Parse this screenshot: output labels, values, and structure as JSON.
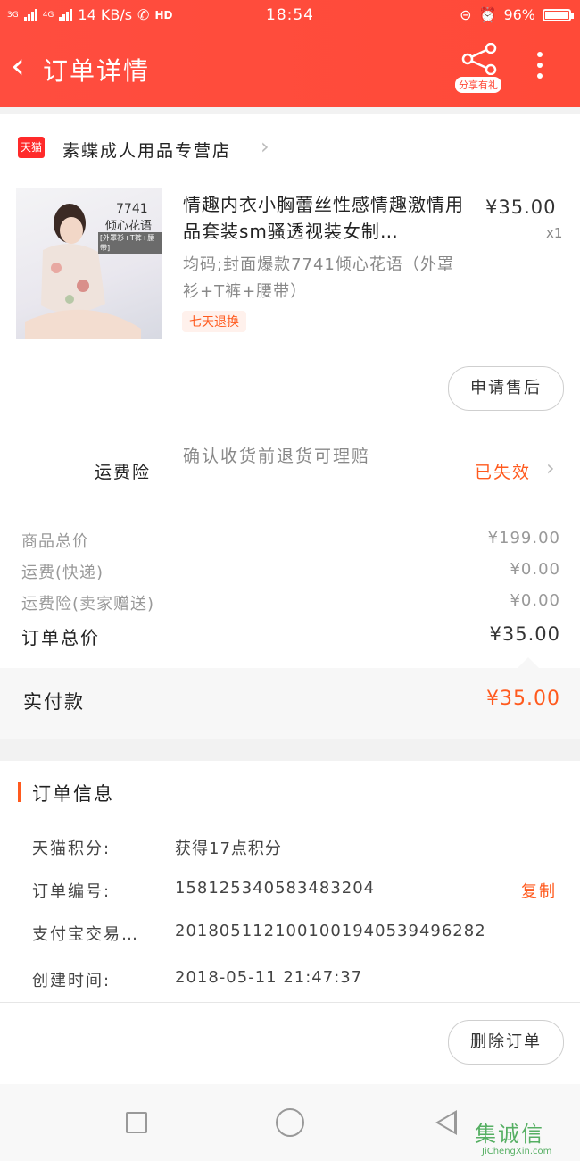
{
  "status_bar": {
    "network1": "3G",
    "network2": "4G",
    "speed": "14 KB/s",
    "hd": "HD",
    "time": "18:54",
    "battery": "96%"
  },
  "header": {
    "title": "订单详情",
    "share_label": "分享有礼"
  },
  "shop": {
    "logo_text": "天猫",
    "name": "素蝶成人用品专营店"
  },
  "product": {
    "image_badge_code": "7741",
    "image_badge_name": "倾心花语",
    "image_badge_sub": "[外罩衫+T裤+腰带]",
    "title": "情趣内衣小胸蕾丝性感情趣激情用品套装sm骚透视装女制…",
    "price": "¥35.00",
    "quantity": "x1",
    "sku": "均码;封面爆款7741倾心花语（外罩衫+T裤+腰带）",
    "tag": "七天退换",
    "after_sale_button": "申请售后"
  },
  "insurance": {
    "label": "运费险",
    "description": "确认收货前退货可理赔",
    "status": "已失效"
  },
  "fees": [
    {
      "label": "商品总价",
      "value": "¥199.00"
    },
    {
      "label": "运费(快递)",
      "value": "¥0.00"
    },
    {
      "label": "运费险(卖家赠送)",
      "value": "¥0.00"
    }
  ],
  "total": {
    "label": "订单总价",
    "value": "¥35.00"
  },
  "paid": {
    "label": "实付款",
    "value": "¥35.00"
  },
  "order_info": {
    "title": "订单信息",
    "rows": [
      {
        "label": "天猫积分:",
        "value": "获得17点积分"
      },
      {
        "label": "订单编号:",
        "value": "158125340583483204"
      },
      {
        "label": "支付宝交易…",
        "value": "2018051121001001940539496282"
      },
      {
        "label": "创建时间:",
        "value": "2018-05-11 21:47:37"
      }
    ],
    "copy_label": "复制"
  },
  "delete_button": "删除订单",
  "watermark": {
    "text": "集诚信",
    "sub": "JiChengXin.com"
  },
  "colors": {
    "header": "#ff4a38",
    "accent": "#ff5a1e"
  }
}
